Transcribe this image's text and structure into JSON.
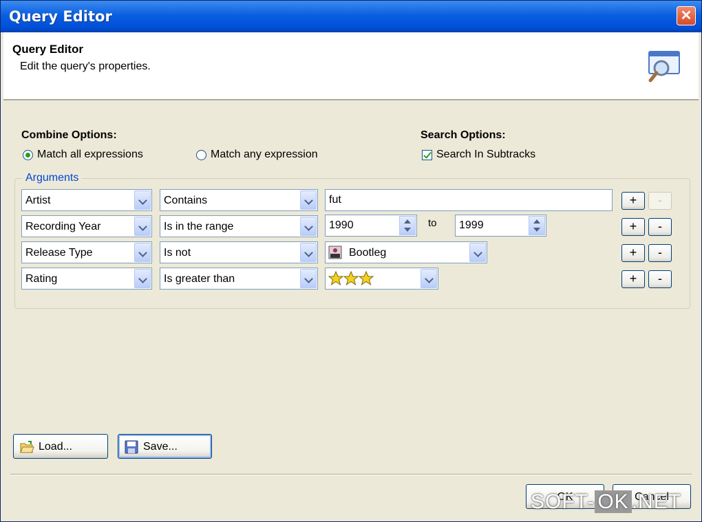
{
  "window": {
    "title": "Query Editor"
  },
  "header": {
    "title": "Query Editor",
    "subtitle": "Edit the query's properties."
  },
  "combine": {
    "label": "Combine Options:",
    "match_all": "Match all expressions",
    "match_any": "Match any expression",
    "selected": "match_all"
  },
  "search": {
    "label": "Search Options:",
    "subtracks_label": "Search In Subtracks",
    "subtracks_checked": true
  },
  "arguments": {
    "legend": "Arguments",
    "rows": [
      {
        "field": "Artist",
        "operator": "Contains",
        "value": "fut"
      },
      {
        "field": "Recording Year",
        "operator": "Is in the range",
        "from": "1990",
        "to_label": "to",
        "to": "1999"
      },
      {
        "field": "Release Type",
        "operator": "Is not",
        "value": "Bootleg"
      },
      {
        "field": "Rating",
        "operator": "Is greater than",
        "value_stars": 3
      }
    ],
    "add_label": "+",
    "remove_label": "-"
  },
  "buttons": {
    "load": "Load...",
    "save": "Save...",
    "ok": "OK",
    "cancel": "Cancel"
  },
  "watermark": {
    "part1": "SOFT-",
    "part2": "OK",
    "part3": ".NET"
  },
  "colors": {
    "title_bar": "#0A5FE0",
    "dialog_bg": "#ECE9D8",
    "accent_legend": "#0046D5",
    "check_green": "#21A121"
  }
}
